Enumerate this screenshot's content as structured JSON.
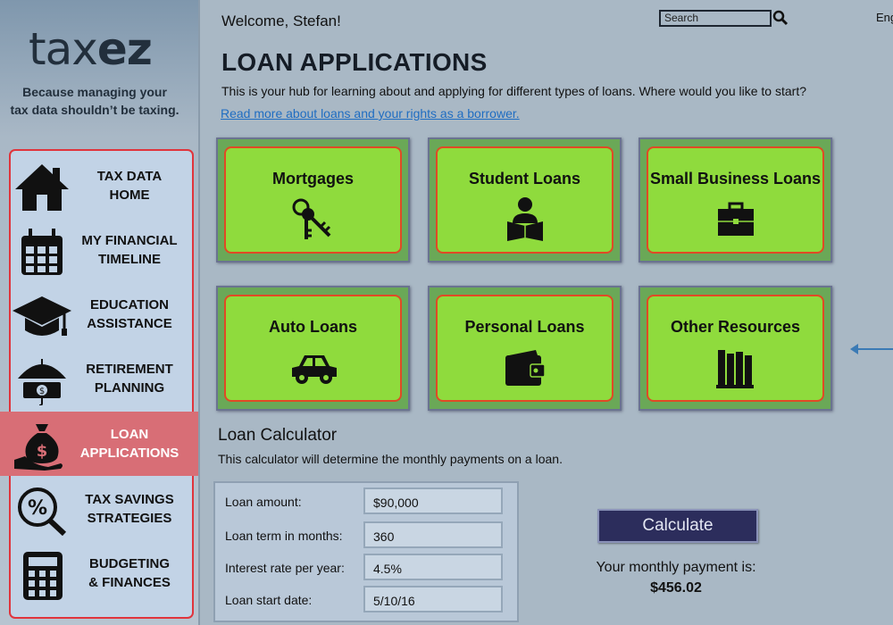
{
  "app": {
    "logo_prefix": "tax",
    "logo_suffix": "ez",
    "tagline_line1": "Because managing your",
    "tagline_line2": "tax data shouldn’t be taxing."
  },
  "nav": {
    "items": [
      {
        "line1": "TAX DATA",
        "line2": "HOME",
        "icon": "house-icon"
      },
      {
        "line1": "MY FINANCIAL",
        "line2": "TIMELINE",
        "icon": "calendar-icon"
      },
      {
        "line1": "EDUCATION",
        "line2": "ASSISTANCE",
        "icon": "graduation-cap-icon"
      },
      {
        "line1": "RETIREMENT",
        "line2": "PLANNING",
        "icon": "umbrella-money-icon"
      },
      {
        "line1": "LOAN",
        "line2": "APPLICATIONS",
        "icon": "money-bag-hand-icon",
        "active": true
      },
      {
        "line1": "TAX SAVINGS",
        "line2": "STRATEGIES",
        "icon": "percent-magnifier-icon"
      },
      {
        "line1": "BUDGETING",
        "line2": "& FINANCES",
        "icon": "calculator-icon"
      }
    ]
  },
  "header": {
    "welcome": "Welcome, Stefan!",
    "search_placeholder": "Search",
    "language": "Eng"
  },
  "page": {
    "title": "LOAN APPLICATIONS",
    "intro": "This is your hub for learning about and applying for different types of loans. Where would you like to start?",
    "link": "Read more about loans and your rights as a borrower."
  },
  "tiles": [
    {
      "label": "Mortgages",
      "icon": "keys-icon"
    },
    {
      "label": "Student Loans",
      "icon": "student-reading-icon"
    },
    {
      "label": "Small Business Loans",
      "icon": "briefcase-icon"
    },
    {
      "label": "Auto Loans",
      "icon": "car-icon"
    },
    {
      "label": "Personal Loans",
      "icon": "wallet-icon"
    },
    {
      "label": "Other Resources",
      "icon": "books-icon"
    }
  ],
  "calculator": {
    "title": "Loan Calculator",
    "description": "This calculator will determine the monthly payments on a loan.",
    "fields": [
      {
        "label": "Loan amount:",
        "value": "$90,000"
      },
      {
        "label": "Loan term in months:",
        "value": "360"
      },
      {
        "label": "Interest rate per year:",
        "value": "4.5%"
      },
      {
        "label": "Loan start date:",
        "value": "5/10/16"
      }
    ],
    "button": "Calculate",
    "result_label": "Your monthly payment is:",
    "result_value": "$456.02"
  },
  "colors": {
    "tile_fill": "#8fdb3d",
    "tile_border": "#e04a25",
    "active_nav": "#d86e76",
    "nav_border": "#e0343c",
    "button": "#2c2d5c",
    "link": "#1f6dc2"
  }
}
